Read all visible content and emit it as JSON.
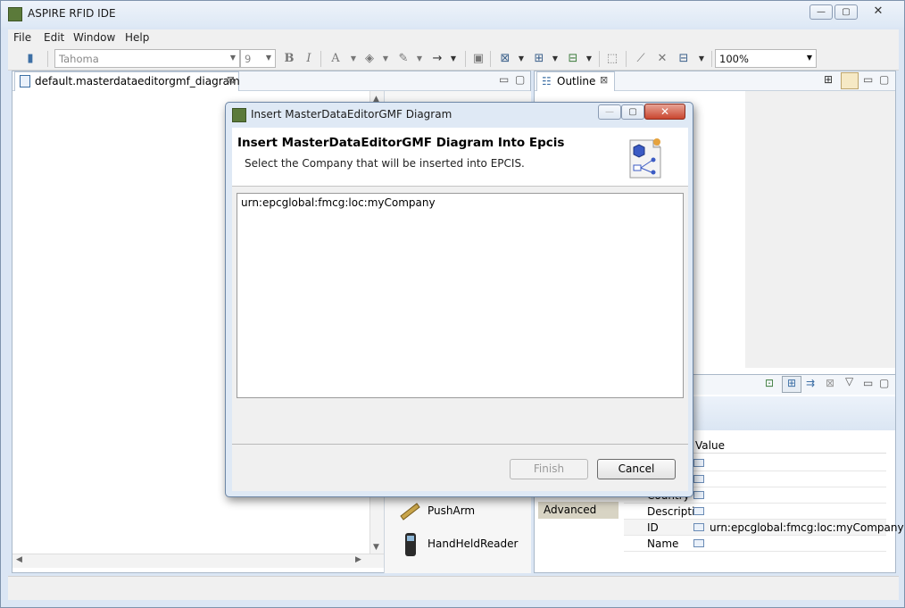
{
  "window": {
    "title": "ASPIRE RFID IDE"
  },
  "menu": [
    "File",
    "Edit",
    "Window",
    "Help"
  ],
  "toolbar": {
    "font": "Tahoma",
    "size": "9",
    "zoom": "100%"
  },
  "editor": {
    "tab_label": "default.masterdataeditorgmf_diagram",
    "palette_items": [
      "PushArm",
      "HandHeldReader"
    ]
  },
  "outline": {
    "tab_label": "Outline"
  },
  "properties": {
    "advanced_tab": "Advanced",
    "value_header": "Value",
    "rows": [
      {
        "key": "Country",
        "value": ""
      },
      {
        "key": "Descripti",
        "value": ""
      },
      {
        "key": "ID",
        "value": "urn:epcglobal:fmcg:loc:myCompany"
      },
      {
        "key": "Name",
        "value": ""
      }
    ]
  },
  "dialog": {
    "title": "Insert MasterDataEditorGMF Diagram",
    "heading": "Insert MasterDataEditorGMF Diagram Into Epcis",
    "description": "Select the Company that will be inserted into EPCIS.",
    "items": [
      "urn:epcglobal:fmcg:loc:myCompany"
    ],
    "finish_label": "Finish",
    "cancel_label": "Cancel"
  }
}
